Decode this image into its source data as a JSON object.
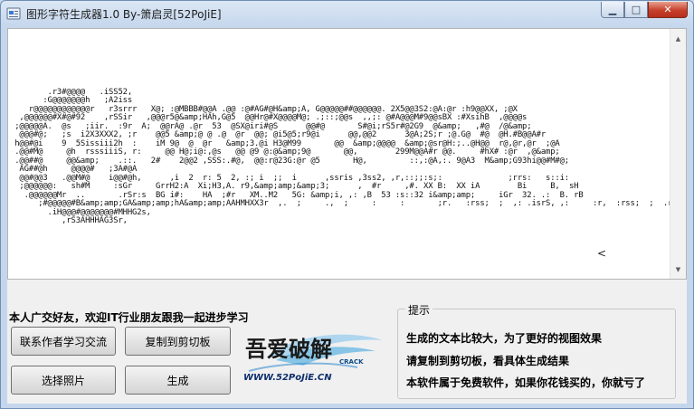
{
  "window": {
    "title": "图形字符生成器1.0 By-箫启灵[52PoJiE]",
    "minimize_glyph": "▁",
    "maximize_glyph": "□",
    "close_glyph": "✕"
  },
  "output": {
    "ascii_art": "\n\n\n        .r3#@@@@   .iSS52,\n       :G@@@@@@@h   ;A2iss\n    r@@@@@@@@@@@@r   r3srrr   X@; :@MBBB#@@A .@@ :@#AG#@H&amp;A, G@@@@@##@@@@@@. 2X5@@3S2:@A:@r :h9@@XX, ;@X\n  ,@@@@@@#X#@#92    ,rSSir   ,@@@r5@&amp;HAh,G@5  @@Hr@#X@@@@M@; .;::;@@s  ,,;: @#A@@@M#9@@sBX :#XsihB  ,@@@@s\n ;@@@@@A.  @s   ;iir.  :9r  A;  @@rA@ .@r  53  @SX@iri#@S      @@#@       S#@i;rS5r#@2G9  @&amp;   ,#@  /@&amp;\n  @@@#@;   ;s  i2X3XXX2, ;r    @@5 &amp;@ @ .@  @r  @@; @i5@5;r9@i      @@,@@2      3@A;2S;r ;@.G@  #@  @H.#B@@A#r\n h@@#@i    9  5Sissiii2h  :    iM 9@  @  @r   &amp;3.@i H3@M99       @@  &amp;@@@@  &amp;@sr@H:;..@H@@  r@,@r,@r  ;@A\n .@@#M@     @h  rsssiiiS, r:     @@ H@;i@:,@s   @@ @9 @:@&amp;9@       @@,        299M@@A#r @@.     #hX# :@r  ,@&amp;\n .@@##@     @@&amp;    .::.   2#    2@@2 ,SSS:.#@,  @@:r@23G:@r @5       H@,         ::,:@A,:. 9@A3  M&amp;G93hi@@#M#@;\n  AG##@h     @@@@#   ;3A#@A\n  @@#@@3   .@@M#@    i@@#@h,      ,i  2  r: 5  2, :; i  ;;  i      ,ssris ,3ss2, ,r,::;;:s;:              ;rrs:   s::i:\n  ;@@@@@@:   sh#M     :sGr     GrrH2:A  Xi;H3,A. r9,&amp;amp;&amp;3;      ,  #r     ,#. XX B:  XX iA        Bi     B,  sH\n   .@@@@@@Mr  ..       .rSr:s  BG i#:    HA  ;#r   XM..M2   5G: &amp;i, ,: ,B  53 :s::32 i&amp;amp;     iGr  32. .:  B. rB\n      ;#@@@@@#B&amp;amp;GA&amp;amp;hA&amp;amp;AAHMHXX3r  ,.  ;     .,  ;     :     :       ;r.   :rss;  ;  ,: .isrS, ,:     :r,  :rss;  ;  .r\n        .iH@@@#@@@@@@@#MHHG2s,\n           ,rS3AHHHAG3Sr,"
  },
  "friend_label": "本人广交好友，欢迎IT行业朋友跟我一起进步学习",
  "buttons": {
    "contact": "联系作者学习交流",
    "copy": "复制到剪切板",
    "select_photo": "选择照片",
    "generate": "生成"
  },
  "tips": {
    "legend": "提示",
    "lines": [
      "生成的文本比较大，为了更好的视图效果",
      "请复制到剪切板，看具体生成结果",
      "本软件属于免费软件，如果你花钱买的，你就亏了"
    ]
  },
  "logo": {
    "main_text": "吾爱破解",
    "sub_text": "CRACK",
    "url": "WWW.52PoJiE.CN"
  },
  "scrollbar": {
    "up_glyph": "▲",
    "down_glyph": "▼"
  },
  "caret_glyph": "<"
}
